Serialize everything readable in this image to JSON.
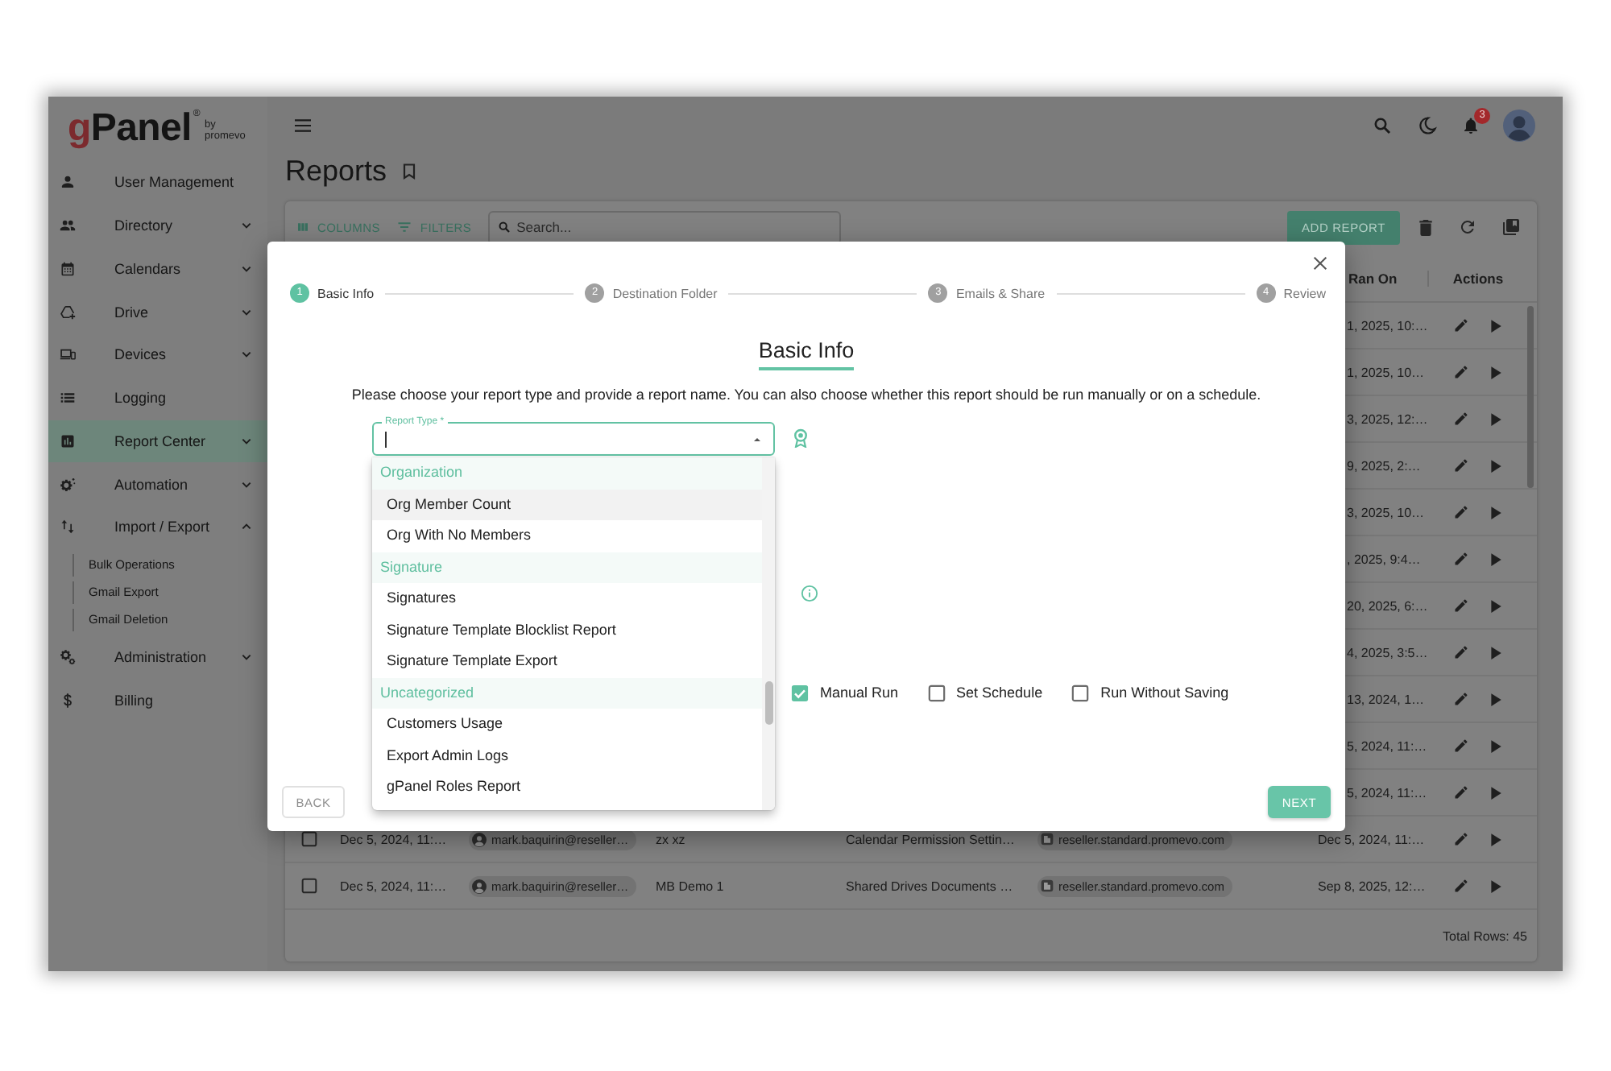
{
  "sidebar": {
    "logo": {
      "mark": "g",
      "name": "Panel",
      "symbol": "®",
      "byline": "by",
      "brand": "promevo"
    },
    "items": [
      {
        "label": "User Management",
        "kind": "link",
        "selected": false
      },
      {
        "label": "Directory",
        "kind": "group",
        "expanded": false,
        "selected": false
      },
      {
        "label": "Calendars",
        "kind": "group",
        "expanded": false,
        "selected": false
      },
      {
        "label": "Drive",
        "kind": "group",
        "expanded": false,
        "selected": false
      },
      {
        "label": "Devices",
        "kind": "group",
        "expanded": false,
        "selected": false
      },
      {
        "label": "Logging",
        "kind": "link",
        "selected": false
      },
      {
        "label": "Report Center",
        "kind": "group",
        "expanded": false,
        "selected": true
      },
      {
        "label": "Automation",
        "kind": "group",
        "expanded": false,
        "selected": false
      },
      {
        "label": "Import / Export",
        "kind": "group",
        "expanded": true,
        "selected": false,
        "children": [
          {
            "label": "Bulk Operations",
            "selected": false
          },
          {
            "label": "Gmail Export",
            "selected": false
          },
          {
            "label": "Gmail Deletion",
            "selected": false
          }
        ]
      },
      {
        "label": "Administration",
        "kind": "group",
        "expanded": false,
        "selected": false
      },
      {
        "label": "Billing",
        "kind": "link",
        "selected": false
      }
    ]
  },
  "top_bar": {
    "notification_count": "3"
  },
  "page": {
    "title": "Reports"
  },
  "toolbar": {
    "columns_button": "COLUMNS",
    "filters_button": "FILTERS",
    "search": {
      "placeholder": "Search..."
    },
    "add_button": "ADD REPORT"
  },
  "table": {
    "columns": [
      {
        "label": "Ran On"
      },
      {
        "label": "Actions"
      }
    ],
    "rows": [
      {
        "kind": "covered",
        "ran_on": "1, 2025, 10:…"
      },
      {
        "kind": "covered",
        "ran_on": "1, 2025, 10…"
      },
      {
        "kind": "covered",
        "ran_on": "3, 2025, 12:…"
      },
      {
        "kind": "covered",
        "ran_on": "9, 2025, 2:…"
      },
      {
        "kind": "covered",
        "ran_on": "3, 2025, 10…"
      },
      {
        "kind": "covered",
        "ran_on": ", 2025, 9:4…"
      },
      {
        "kind": "covered",
        "ran_on": "20, 2025, 6:…"
      },
      {
        "kind": "covered",
        "ran_on": "4, 2025, 3:5…"
      },
      {
        "kind": "covered",
        "ran_on": "13, 2024, 1…"
      },
      {
        "kind": "covered",
        "ran_on": "5, 2024, 11:…"
      },
      {
        "kind": "covered",
        "ran_on": "5, 2024, 11:…"
      },
      {
        "kind": "full",
        "checked": false,
        "column_2": "Dec 5, 2024, 11:…",
        "column_3": "mark.baquirin@reseller…",
        "column_4": "zx xz",
        "column_5": "Calendar Permission Settin…",
        "column_6": "reseller.standard.promevo.com",
        "ran_on": "Dec 5, 2024, 11:…"
      },
      {
        "kind": "full",
        "checked": false,
        "column_2": "Dec 5, 2024, 11:…",
        "column_3": "mark.baquirin@reseller…",
        "column_4": "MB Demo 1",
        "column_5": "Shared Drives Documents …",
        "column_6": "reseller.standard.promevo.com",
        "ran_on": "Sep 8, 2025, 12:…"
      }
    ],
    "total": "Total Rows: 45"
  },
  "dialog": {
    "steps": [
      {
        "number": "1",
        "label": "Basic Info",
        "selected": true
      },
      {
        "number": "2",
        "label": "Destination Folder",
        "selected": false
      },
      {
        "number": "3",
        "label": "Emails & Share",
        "selected": false
      },
      {
        "number": "4",
        "label": "Review",
        "selected": false
      }
    ],
    "heading": "Basic Info",
    "description": "Please choose your report type and provide a report name. You can also choose whether this report should be run manually or on a schedule.",
    "report_type": {
      "label": "Report Type *",
      "expanded": true,
      "options": [
        {
          "kind": "group",
          "label": "Organization"
        },
        {
          "kind": "option",
          "label": "Org Member Count",
          "selected": true
        },
        {
          "kind": "option",
          "label": "Org With No Members",
          "selected": false
        },
        {
          "kind": "group",
          "label": "Signature"
        },
        {
          "kind": "option",
          "label": "Signatures",
          "selected": false
        },
        {
          "kind": "option",
          "label": "Signature Template Blocklist Report",
          "selected": false
        },
        {
          "kind": "option",
          "label": "Signature Template Export",
          "selected": false
        },
        {
          "kind": "group",
          "label": "Uncategorized"
        },
        {
          "kind": "option",
          "label": "Customers Usage",
          "selected": false
        },
        {
          "kind": "option",
          "label": "Export Admin Logs",
          "selected": false
        },
        {
          "kind": "option",
          "label": "gPanel Roles Report",
          "selected": false
        }
      ]
    },
    "run_options": [
      {
        "label": "Manual Run",
        "checked": true
      },
      {
        "label": "Set Schedule",
        "checked": false
      },
      {
        "label": "Run Without Saving",
        "checked": false
      }
    ],
    "back_button": {
      "label": "BACK",
      "disabled": true
    },
    "next_button": {
      "label": "NEXT",
      "disabled": false
    }
  }
}
